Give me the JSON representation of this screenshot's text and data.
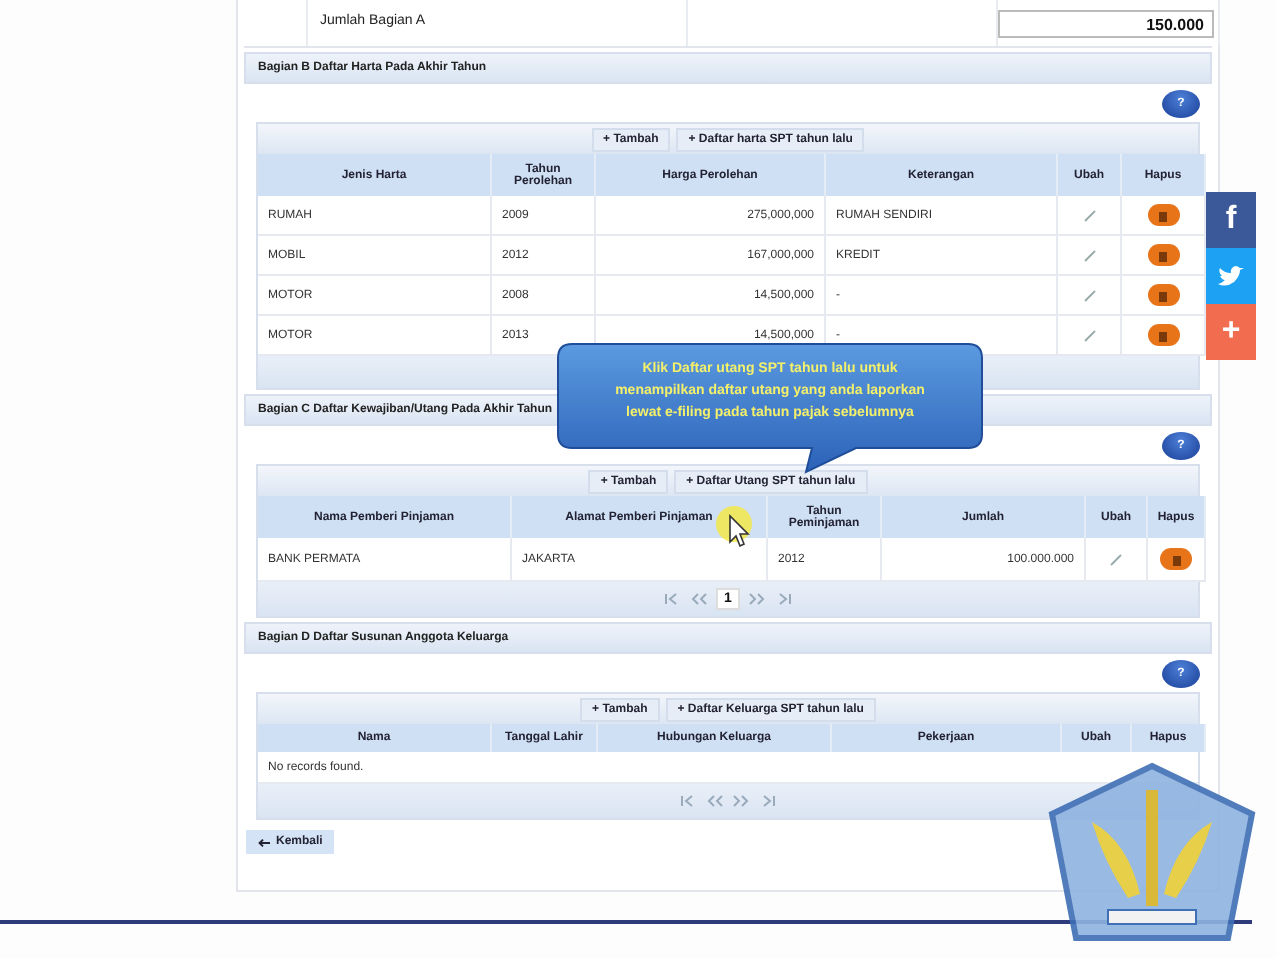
{
  "summary_row": {
    "label": "Jumlah Bagian A",
    "value": "150.000"
  },
  "sections": [
    {
      "title": "Bagian B Daftar Harta Pada Akhir Tahun",
      "help": "?",
      "toolbar": [
        "+ Tambah",
        "+ Daftar harta SPT tahun lalu"
      ],
      "columns": [
        {
          "label": "Jenis Harta",
          "kind": "text"
        },
        {
          "label": "Tahun Perolehan",
          "kind": "text"
        },
        {
          "label": "Harga Perolehan",
          "kind": "number"
        },
        {
          "label": "Keterangan",
          "kind": "text"
        },
        {
          "label": "Ubah",
          "kind": "edit"
        },
        {
          "label": "Hapus",
          "kind": "delete"
        }
      ],
      "rows": [
        [
          "RUMAH",
          "2009",
          "275,000,000",
          "RUMAH SENDIRI"
        ],
        [
          "MOBIL",
          "2012",
          "167,000,000",
          "KREDIT"
        ],
        [
          "MOTOR",
          "2008",
          "14,500,000",
          "-"
        ],
        [
          "MOTOR",
          "2013",
          "14,500,000",
          "-"
        ]
      ]
    },
    {
      "title": "Bagian C Daftar Kewajiban/Utang Pada Akhir Tahun",
      "help": "?",
      "toolbar": [
        "+ Tambah",
        "+ Daftar Utang SPT tahun lalu"
      ],
      "columns": [
        {
          "label": "Nama Pemberi Pinjaman",
          "kind": "text"
        },
        {
          "label": "Alamat Pemberi Pinjaman",
          "kind": "text"
        },
        {
          "label": "Tahun Peminjaman",
          "kind": "text"
        },
        {
          "label": "Jumlah",
          "kind": "number"
        },
        {
          "label": "Ubah",
          "kind": "edit"
        },
        {
          "label": "Hapus",
          "kind": "delete"
        }
      ],
      "rows": [
        [
          "BANK PERMATA",
          "JAKARTA",
          "2012",
          "100.000.000"
        ]
      ],
      "pager": {
        "navigation": true,
        "page": "1"
      }
    },
    {
      "title": "Bagian D Daftar Susunan Anggota Keluarga",
      "help": "?",
      "toolbar": [
        "+ Tambah",
        "+ Daftar Keluarga SPT tahun lalu"
      ],
      "columns": [
        {
          "label": "Nama"
        },
        {
          "label": "Tanggal Lahir"
        },
        {
          "label": "Hubungan Keluarga"
        },
        {
          "label": "Pekerjaan"
        },
        {
          "label": "Ubah"
        },
        {
          "label": "Hapus"
        }
      ],
      "empty_message": "No records found.",
      "pager": {
        "navigation": true
      }
    }
  ],
  "back_button": "Kembali",
  "callout": "Klik Daftar utang SPT tahun lalu untuk menampilkan daftar utang yang anda laporkan lewat e-filing pada tahun pajak sebelumnya",
  "share_buttons": [
    {
      "kind": "facebook",
      "label": "f"
    },
    {
      "kind": "twitter"
    },
    {
      "kind": "more",
      "label": "+"
    }
  ]
}
